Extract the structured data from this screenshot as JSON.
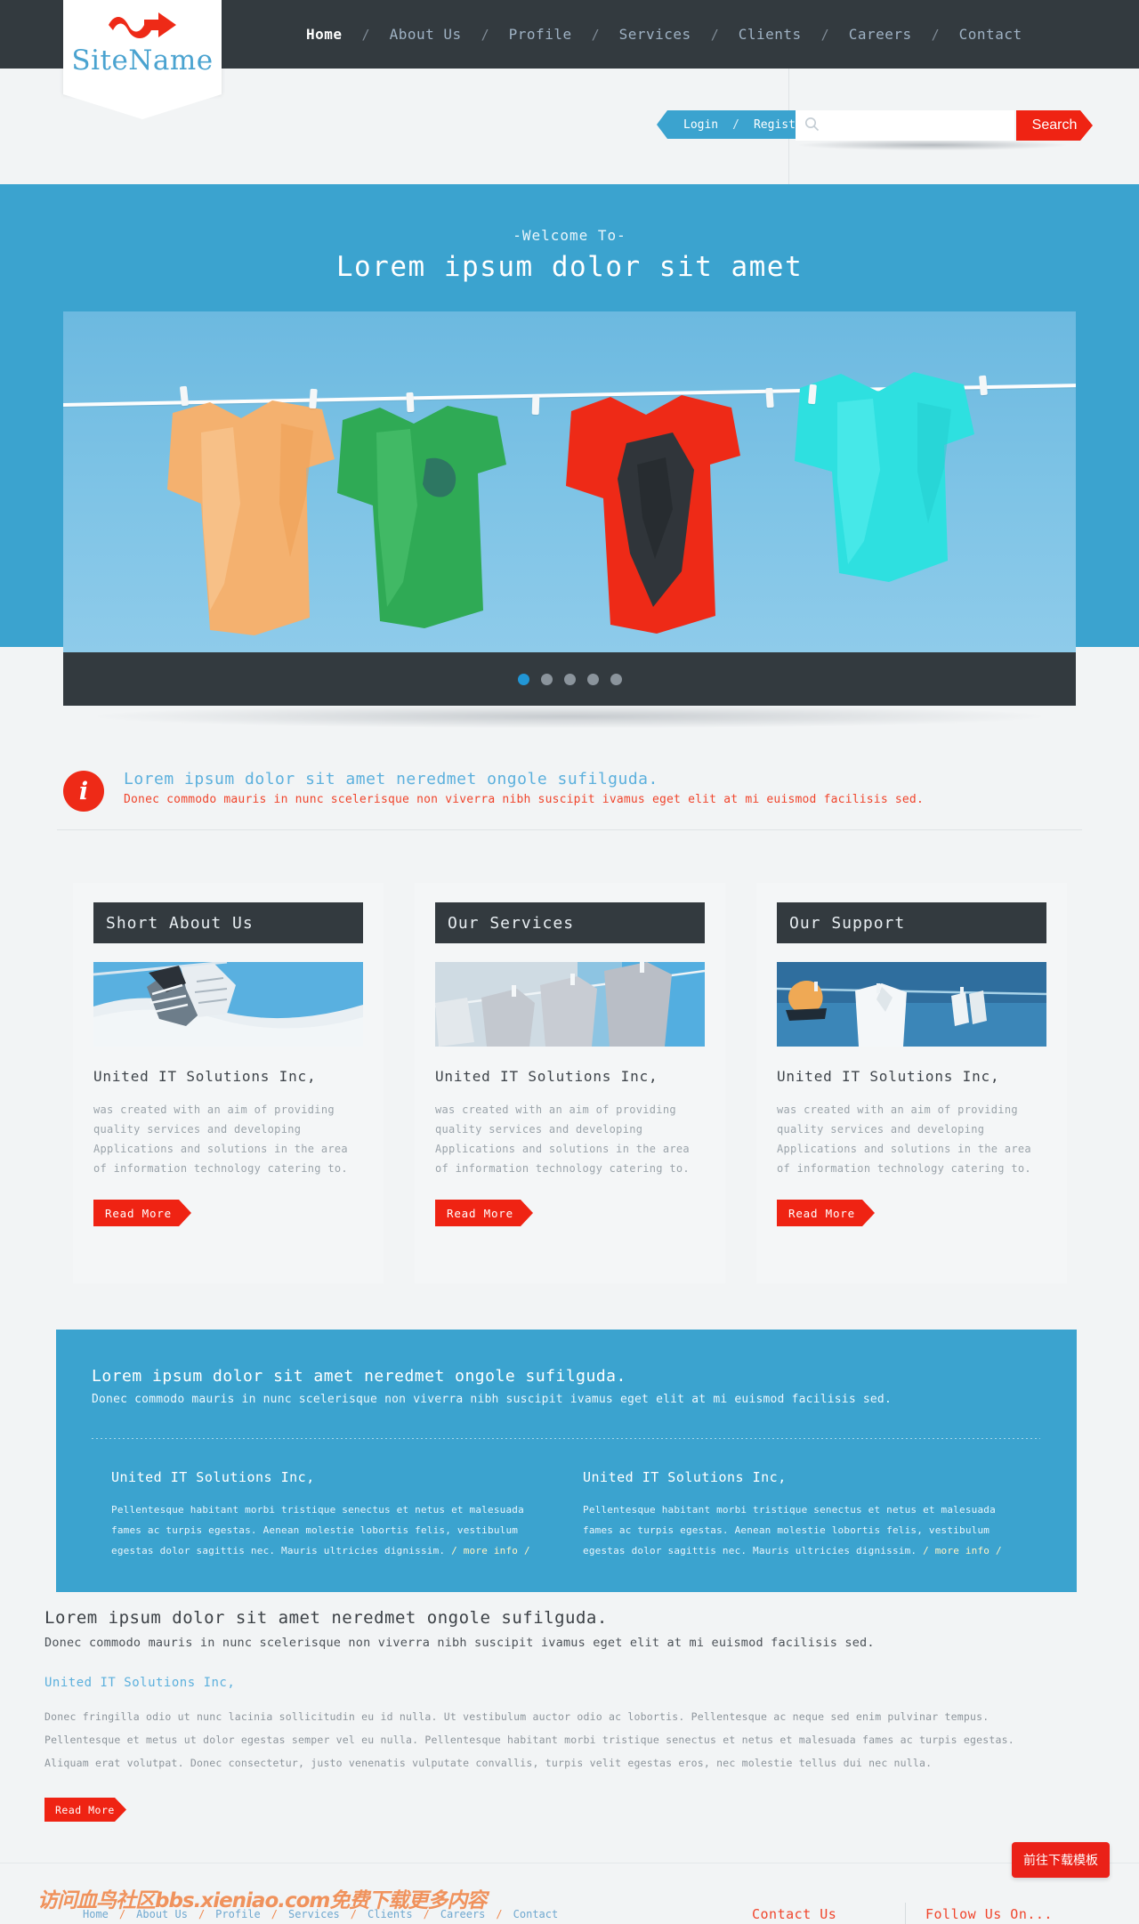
{
  "brand": {
    "name": "SiteName",
    "logo_icon": "wave-arrow-icon",
    "accent_blue": "#3ba3cf",
    "accent_red": "#ef2313",
    "dark": "#333a3f"
  },
  "nav": {
    "separator": "/",
    "items": [
      {
        "label": "Home",
        "active": true
      },
      {
        "label": "About Us",
        "active": false
      },
      {
        "label": "Profile",
        "active": false
      },
      {
        "label": "Services",
        "active": false
      },
      {
        "label": "Clients",
        "active": false
      },
      {
        "label": "Careers",
        "active": false
      },
      {
        "label": "Contact",
        "active": false
      }
    ]
  },
  "account_bar": {
    "login_label": "Login",
    "separator": "/",
    "register_label": "Register"
  },
  "search": {
    "icon": "search-icon",
    "placeholder": "",
    "value": "",
    "button_label": "Search"
  },
  "hero": {
    "eyebrow": "-Welcome To-",
    "title": "Lorem ipsum dolor sit amet"
  },
  "carousel": {
    "slide_alt": "clothesline-with-colored-garments",
    "dots": 5,
    "active_dot": 0
  },
  "info_strip": {
    "icon": "info-icon",
    "icon_glyph": "i",
    "title": "Lorem ipsum dolor sit amet neredmet ongole sufilguda.",
    "subtitle": "Donec commodo mauris in nunc scelerisque non viverra nibh suscipit ivamus eget elit at mi euismod facilisis sed."
  },
  "cards": [
    {
      "heading": "Short About Us",
      "image_alt": "sneakers-on-clothesline",
      "title": "United IT Solutions Inc,",
      "body": "was created with an aim of providing quality services and developing Applications and solutions in the area of information technology catering to.",
      "button_label": "Read More"
    },
    {
      "heading": "Our Services",
      "image_alt": "grey-shirts-on-clothesline",
      "title": "United IT Solutions Inc,",
      "body": "was created with an aim of providing quality services and developing Applications and solutions in the area of information technology catering to.",
      "button_label": "Read More"
    },
    {
      "heading": "Our Support",
      "image_alt": "white-shirt-and-shoes-on-clothesline",
      "title": "United IT Solutions Inc,",
      "body": "was created with an aim of providing quality services and developing Applications and solutions in the area of information technology catering to.",
      "button_label": "Read More"
    }
  ],
  "blue_panel": {
    "title": "Lorem ipsum dolor sit amet neredmet ongole sufilguda.",
    "subtitle": "Donec commodo mauris in nunc scelerisque non viverra nibh suscipit ivamus eget elit at mi euismod facilisis sed.",
    "columns": [
      {
        "title": "United IT Solutions Inc,",
        "body": "Pellentesque habitant morbi tristique senectus et netus et malesuada fames ac turpis egestas. Aenean molestie lobortis felis, vestibulum egestas dolor sagittis nec. Mauris ultricies dignissim.",
        "more_label": "/ more info /"
      },
      {
        "title": "United IT Solutions Inc,",
        "body": "Pellentesque habitant morbi tristique senectus et netus et malesuada fames ac turpis egestas. Aenean molestie lobortis felis, vestibulum egestas dolor sagittis nec. Mauris ultricies dignissim.",
        "more_label": "/ more info /"
      }
    ]
  },
  "bottom_section": {
    "title": "Lorem ipsum dolor sit amet neredmet ongole sufilguda.",
    "subtitle": "Donec commodo mauris in nunc scelerisque non viverra nibh suscipit ivamus eget elit at mi euismod facilisis sed.",
    "link": "United IT Solutions Inc,",
    "body": "Donec fringilla odio ut nunc lacinia sollicitudin eu id nulla. Ut vestibulum auctor odio ac lobortis. Pellentesque ac neque sed enim pulvinar tempus. Pellentesque et metus ut dolor egestas semper vel eu nulla. Pellentesque habitant morbi tristique senectus et netus et malesuada fames ac turpis egestas. Aliquam erat volutpat. Donec consectetur, justo venenatis vulputate convallis, turpis velit egestas eros, nec molestie tellus dui nec nulla.",
    "button_label": "Read More"
  },
  "download_button": {
    "label": "前往下载模板"
  },
  "footer": {
    "watermark": "访问血鸟社区bbs.xieniao.com免费下载更多内容",
    "separator": "/",
    "nav": [
      {
        "label": "Home"
      },
      {
        "label": "About Us"
      },
      {
        "label": "Profile"
      },
      {
        "label": "Services"
      },
      {
        "label": "Clients"
      },
      {
        "label": "Careers"
      },
      {
        "label": "Contact"
      }
    ],
    "contact_label": "Contact Us",
    "follow_label": "Follow Us On..."
  }
}
